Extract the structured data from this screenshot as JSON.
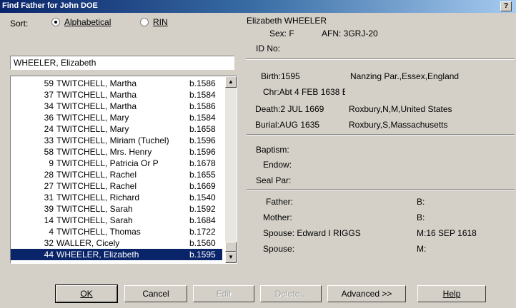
{
  "window": {
    "title": "Find Father for John DOE",
    "help_icon": "?"
  },
  "sort": {
    "label": "Sort:",
    "options": [
      {
        "label": "Alphabetical",
        "selected": true
      },
      {
        "label": "RIN",
        "selected": false
      }
    ]
  },
  "search": {
    "value": "WHEELER, Elizabeth"
  },
  "list": {
    "rows": [
      {
        "rin": "59",
        "name": "TWITCHELL, Martha",
        "birth": "b.1586"
      },
      {
        "rin": "37",
        "name": "TWITCHELL, Martha",
        "birth": "b.1584"
      },
      {
        "rin": "34",
        "name": "TWITCHELL, Martha",
        "birth": "b.1586"
      },
      {
        "rin": "36",
        "name": "TWITCHELL, Mary",
        "birth": "b.1584"
      },
      {
        "rin": "24",
        "name": "TWITCHELL, Mary",
        "birth": "b.1658"
      },
      {
        "rin": "33",
        "name": "TWITCHELL, Miriam (Tuchel)",
        "birth": "b.1596"
      },
      {
        "rin": "58",
        "name": "TWITCHELL, Mrs. Henry",
        "birth": "b.1596"
      },
      {
        "rin": "9",
        "name": "TWITCHELL, Patricia Or P",
        "birth": "b.1678"
      },
      {
        "rin": "28",
        "name": "TWITCHELL, Rachel",
        "birth": "b.1655"
      },
      {
        "rin": "27",
        "name": "TWITCHELL, Rachel",
        "birth": "b.1669"
      },
      {
        "rin": "31",
        "name": "TWITCHELL, Richard",
        "birth": "b.1540"
      },
      {
        "rin": "39",
        "name": "TWITCHELL, Sarah",
        "birth": "b.1592"
      },
      {
        "rin": "14",
        "name": "TWITCHELL, Sarah",
        "birth": "b.1684"
      },
      {
        "rin": "4",
        "name": "TWITCHELL, Thomas",
        "birth": "b.1722"
      },
      {
        "rin": "32",
        "name": "WALLER, Cicely",
        "birth": "b.1560"
      },
      {
        "rin": "44",
        "name": "WHEELER, Elizabeth",
        "birth": "b.1595",
        "selected": true
      }
    ]
  },
  "details": {
    "name": "Elizabeth WHEELER",
    "sex": "Sex: F",
    "afn": "AFN: 3GRJ-20",
    "id_no": "ID No:",
    "birth_label": "Birth:1595",
    "birth_place": "Nanzing Par.,Essex,England",
    "chr_label": "Chr:Abt 4 FEB 1638 E",
    "death_label": "Death:2 JUL 1669",
    "death_place": "Roxbury,N,M,United States",
    "burial_label": "Burial:AUG 1635",
    "burial_place": "Roxbury,S,Massachusetts",
    "baptism": "Baptism:",
    "endow": "Endow:",
    "seal_par": "Seal Par:",
    "father": "Father:",
    "father_b": "B:",
    "mother": "Mother:",
    "mother_b": "B:",
    "spouse1": "Spouse: Edward I RIGGS",
    "spouse1_m": "M:16 SEP 1618",
    "spouse2": "Spouse:",
    "spouse2_m": "M:"
  },
  "buttons": {
    "ok": "OK",
    "cancel": "Cancel",
    "edit": "Edit",
    "delete": "Delete...",
    "advanced": "Advanced >>",
    "help": "Help"
  }
}
